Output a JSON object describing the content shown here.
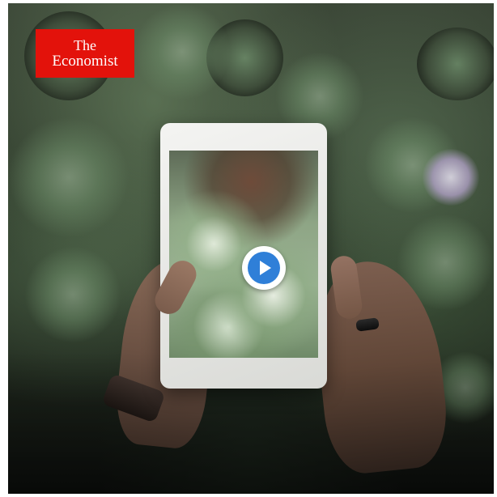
{
  "brand": {
    "line1": "The",
    "line2": "Economist",
    "color": "#e3120b"
  },
  "video": {
    "play_icon": "play-icon",
    "accent": "#2f7fd8"
  }
}
